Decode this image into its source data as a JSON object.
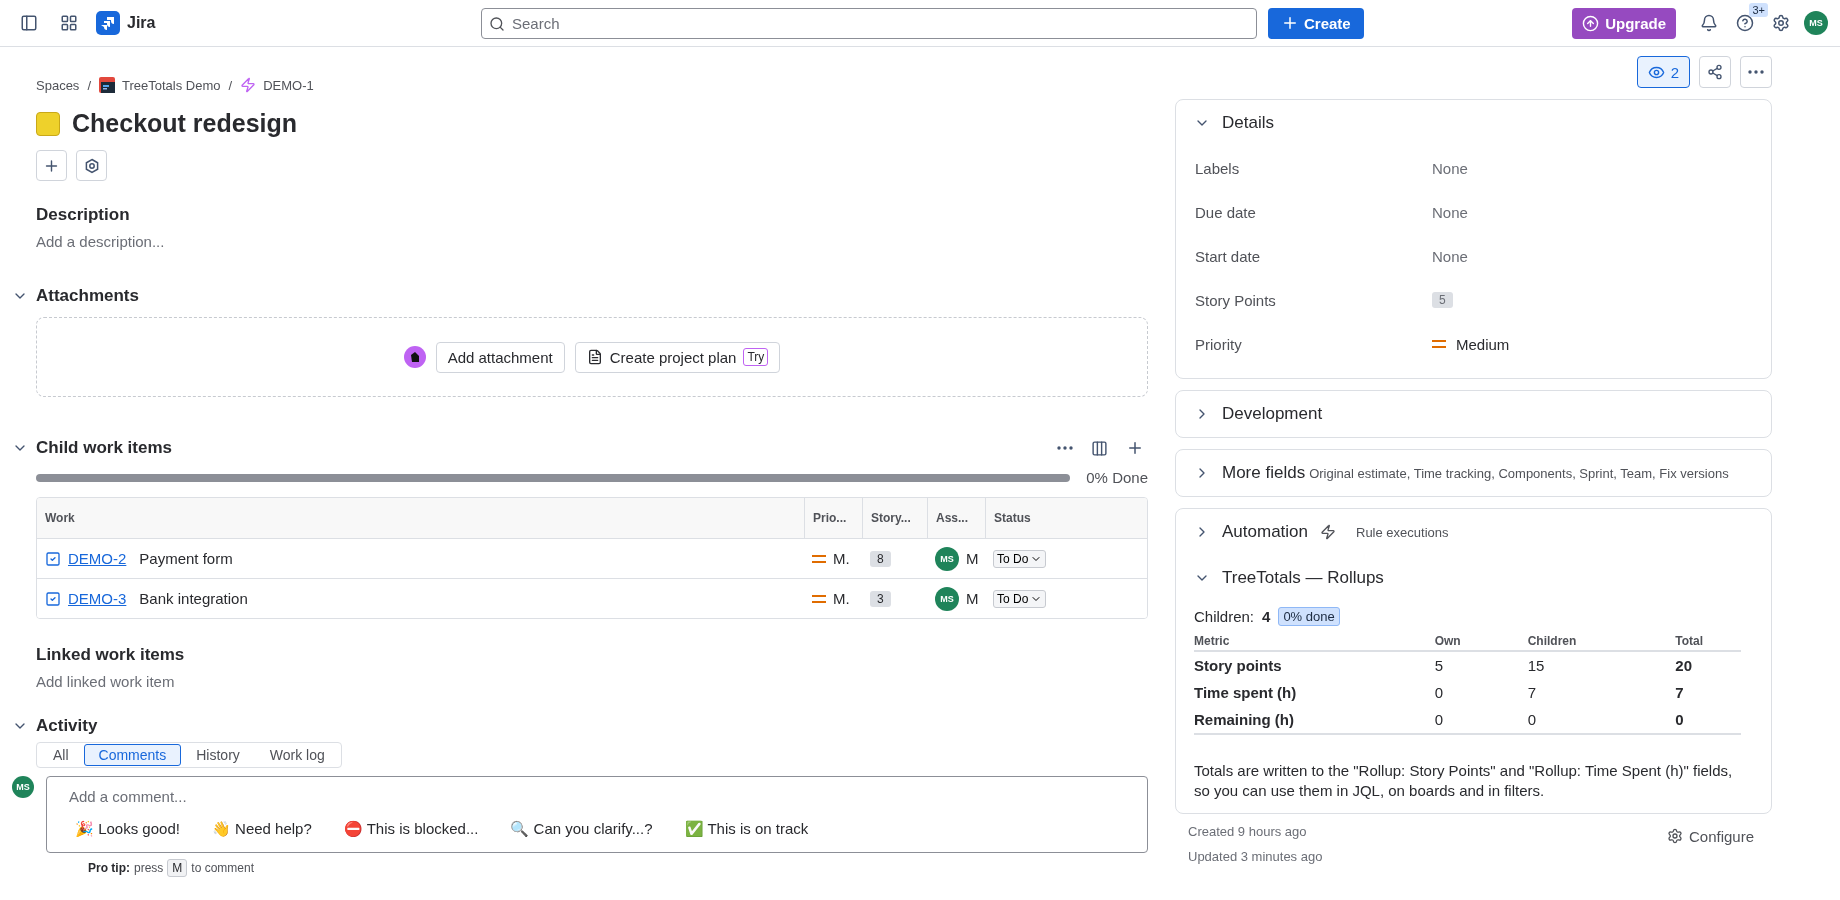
{
  "topbar": {
    "product": "Jira",
    "search": {
      "placeholder": "Search"
    },
    "create": "Create",
    "upgrade": "Upgrade",
    "help_badge": "3+",
    "avatar": "MS"
  },
  "breadcrumb_separator": "/",
  "breadcrumbs": [
    {
      "label": "Spaces",
      "kind": "text"
    },
    {
      "label": "TreeTotals Demo",
      "kind": "space"
    },
    {
      "label": "DEMO-1",
      "kind": "epic"
    }
  ],
  "issue": {
    "title": "Checkout redesign"
  },
  "description": {
    "heading": "Description",
    "placeholder": "Add a description..."
  },
  "attachments": {
    "heading": "Attachments",
    "expanded": true,
    "add": "Add attachment",
    "plan": "Create project plan",
    "plan_badge": "Try"
  },
  "child_items": {
    "heading": "Child work items",
    "expanded": true,
    "progress": {
      "level": 0,
      "reading": "0% Done"
    },
    "columns": [
      "Work",
      "Prio...",
      "Story...",
      "Ass...",
      "Status"
    ],
    "rows": [
      {
        "key": "DEMO-2",
        "summary": "Payment form",
        "priority": "M.",
        "points": "8",
        "assignee_initials": "MS",
        "assignee": "M",
        "status": "To Do"
      },
      {
        "key": "DEMO-3",
        "summary": "Bank integration",
        "priority": "M.",
        "points": "3",
        "assignee_initials": "MS",
        "assignee": "M",
        "status": "To Do"
      }
    ]
  },
  "linked": {
    "heading": "Linked work items",
    "placeholder": "Add linked work item"
  },
  "activity": {
    "heading": "Activity",
    "expanded": true,
    "tabs": [
      {
        "label": "All",
        "selected": false
      },
      {
        "label": "Comments",
        "selected": true
      },
      {
        "label": "History",
        "selected": false
      },
      {
        "label": "Work log",
        "selected": false
      }
    ],
    "avatar": "MS",
    "comment": {
      "placeholder": "Add a comment...",
      "suggestions": [
        "🎉 Looks good!",
        "👋 Need help?",
        "⛔ This is blocked...",
        "🔍 Can you clarify...?",
        "✅ This is on track"
      ]
    },
    "pro_tip": {
      "label": "Pro tip:",
      "before": "press",
      "key": "M",
      "after": "to comment"
    }
  },
  "header_actions": {
    "watchers": "2"
  },
  "details": {
    "heading": "Details",
    "expanded": true,
    "fields": [
      {
        "label": "Labels",
        "value": "None",
        "kind": "text"
      },
      {
        "label": "Due date",
        "value": "None",
        "kind": "text"
      },
      {
        "label": "Start date",
        "value": "None",
        "kind": "text"
      },
      {
        "label": "Story Points",
        "value": "5",
        "kind": "badge"
      },
      {
        "label": "Priority",
        "value": "Medium",
        "kind": "priority"
      }
    ]
  },
  "panels": [
    {
      "title": "Development",
      "expanded": false
    },
    {
      "title": "More fields",
      "subtitle": "Original estimate, Time tracking, Components, Sprint, Team, Fix versions",
      "expanded": false
    }
  ],
  "automation": {
    "title": "Automation",
    "subtitle": "Rule executions",
    "expanded": false
  },
  "rollups": {
    "title": "TreeTotals — Rollups",
    "expanded": true,
    "children_label": "Children:",
    "children_count": "4",
    "done_badge": "0% done",
    "columns": [
      "Metric",
      "Own",
      "Children",
      "Total"
    ],
    "rows": [
      {
        "metric": "Story points",
        "own": "5",
        "children": "15",
        "total": "20"
      },
      {
        "metric": "Time spent (h)",
        "own": "0",
        "children": "7",
        "total": "7"
      },
      {
        "metric": "Remaining (h)",
        "own": "0",
        "children": "0",
        "total": "0"
      }
    ],
    "note": "Totals are written to the \"Rollup: Story Points\" and \"Rollup: Time Spent (h)\" fields, so you can use them in JQL, on boards and in filters."
  },
  "meta": {
    "created": "Created 9 hours ago",
    "updated": "Updated 3 minutes ago",
    "configure": "Configure"
  }
}
